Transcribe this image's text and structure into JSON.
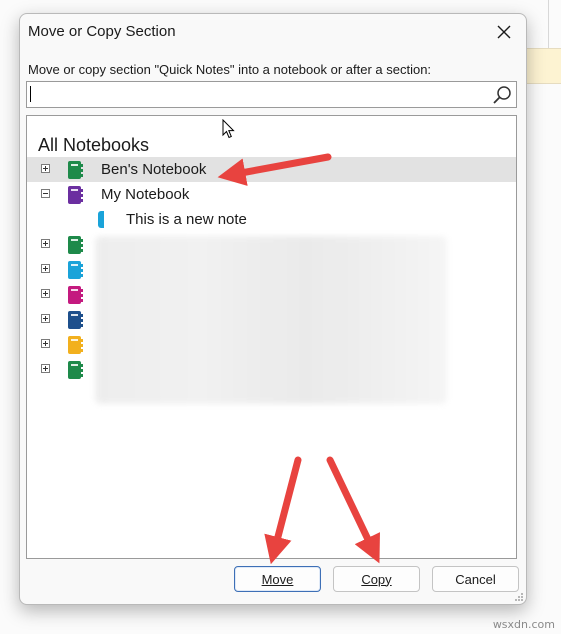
{
  "dialog": {
    "title": "Move or Copy Section",
    "instruction": "Move or copy section \"Quick Notes\" into a notebook or after a section:",
    "search": {
      "value": "",
      "placeholder": ""
    },
    "tree": {
      "header": "All Notebooks",
      "notebooks": [
        {
          "label": "Ben's Notebook",
          "icon": "notebook-icon",
          "color": "#1e8a4a",
          "expanded": false,
          "selected": true
        },
        {
          "label": "My Notebook",
          "icon": "notebook-icon",
          "color": "#6b2fa0",
          "expanded": true,
          "selected": false,
          "sections": [
            {
              "label": "This is a new note",
              "color": "#1aa3d9"
            }
          ]
        },
        {
          "label": "",
          "icon": "notebook-icon",
          "color": "#1e8a4a",
          "expanded": false,
          "blurred": true
        },
        {
          "label": "",
          "icon": "notebook-icon",
          "color": "#1aa3d9",
          "expanded": false,
          "blurred": true
        },
        {
          "label": "",
          "icon": "notebook-icon",
          "color": "#c41a7f",
          "expanded": false,
          "blurred": true
        },
        {
          "label": "",
          "icon": "notebook-icon",
          "color": "#1d4f8c",
          "expanded": false,
          "blurred": true
        },
        {
          "label": "",
          "icon": "notebook-icon",
          "color": "#f2b01e",
          "expanded": false,
          "blurred": true
        },
        {
          "label": "",
          "icon": "notebook-icon",
          "color": "#1e8a4a",
          "expanded": false,
          "blurred": true
        }
      ]
    },
    "buttons": {
      "move": "Move",
      "copy": "Copy",
      "cancel": "Cancel"
    }
  },
  "annotations": {
    "arrow_color": "#e8433f"
  },
  "watermark": "wsxdn.com"
}
